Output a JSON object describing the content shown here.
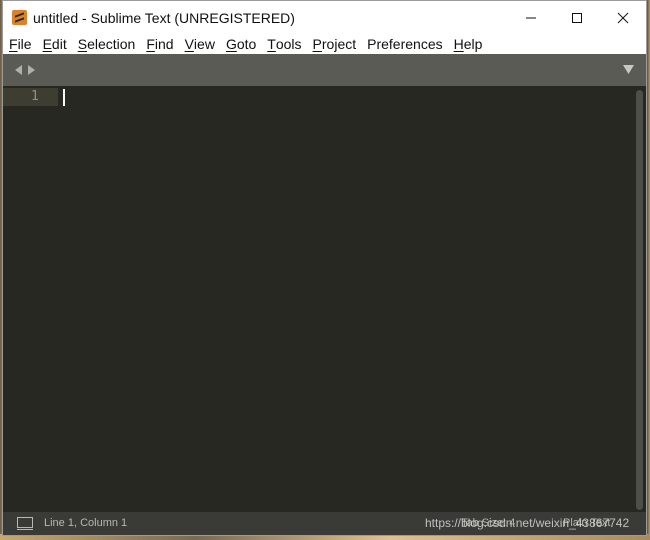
{
  "window": {
    "title": "untitled - Sublime Text (UNREGISTERED)"
  },
  "menu": [
    {
      "mnemonic": "F",
      "rest": "ile"
    },
    {
      "mnemonic": "E",
      "rest": "dit"
    },
    {
      "mnemonic": "S",
      "rest": "election"
    },
    {
      "mnemonic": "F",
      "rest": "ind"
    },
    {
      "mnemonic": "V",
      "rest": "iew"
    },
    {
      "mnemonic": "G",
      "rest": "oto"
    },
    {
      "mnemonic": "T",
      "rest": "ools"
    },
    {
      "mnemonic": "P",
      "rest": "roject"
    },
    {
      "mnemonic": "",
      "rest": "Preferences"
    },
    {
      "mnemonic": "H",
      "rest": "elp"
    }
  ],
  "editor": {
    "line_number": "1"
  },
  "status": {
    "position": "Line 1, Column 1",
    "tab_size": "Tab Size: 4",
    "syntax": "Plain Text"
  },
  "watermark": "https://blog.csdn.net/weixin_43867742",
  "colors": {
    "editor_bg": "#272822",
    "tabbar_bg": "#5a5b55",
    "statusbar_bg": "#3a3b36",
    "icon_orange": "#d9822b"
  },
  "icons": [
    "sublime-logo-icon",
    "minimize-icon",
    "maximize-icon",
    "close-icon",
    "tab-back-icon",
    "tab-forward-icon",
    "tab-dropdown-icon",
    "panel-switcher-icon"
  ]
}
